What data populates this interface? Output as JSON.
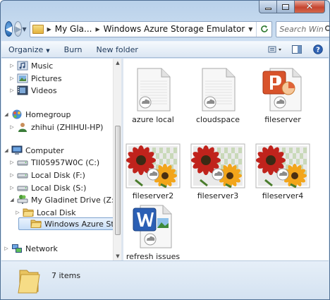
{
  "window": {
    "caption_buttons": {
      "minimize": "minimize",
      "maximize": "maximize",
      "close": "✕"
    }
  },
  "address": {
    "crumbs": [
      "My Gla...",
      "Windows Azure Storage Emulator"
    ],
    "search_placeholder": "Search Win..."
  },
  "toolbar": {
    "organize_label": "Organize",
    "burn_label": "Burn",
    "new_folder_label": "New folder"
  },
  "nav_tree": [
    {
      "label": "Music",
      "icon": "music-icon",
      "level": 1,
      "expander": "▷"
    },
    {
      "label": "Pictures",
      "icon": "pictures-icon",
      "level": 1,
      "expander": "▷"
    },
    {
      "label": "Videos",
      "icon": "videos-icon",
      "level": 1,
      "expander": "▷"
    },
    {
      "label": "Homegroup",
      "icon": "homegroup-icon",
      "level": 0,
      "expander": "◢"
    },
    {
      "label": "zhihui (ZHIHUI-HP)",
      "icon": "user-icon",
      "level": 1,
      "expander": "▷"
    },
    {
      "label": "Computer",
      "icon": "computer-icon",
      "level": 0,
      "expander": "◢"
    },
    {
      "label": "TII05957W0C (C:)",
      "icon": "drive-icon",
      "level": 1,
      "expander": "▷"
    },
    {
      "label": "Local Disk (F:)",
      "icon": "drive-icon",
      "level": 1,
      "expander": "▷"
    },
    {
      "label": "Local Disk (S:)",
      "icon": "drive-icon",
      "level": 1,
      "expander": "▷"
    },
    {
      "label": "My Gladinet Drive (Z:)",
      "icon": "network-drive-icon",
      "level": 1,
      "expander": "◢"
    },
    {
      "label": "Local Disk",
      "icon": "folder-icon",
      "level": 2,
      "expander": "▷"
    },
    {
      "label": "Windows Azure Storag",
      "icon": "folder-icon",
      "level": 2,
      "expander": "",
      "selected": true
    },
    {
      "label": "Network",
      "icon": "network-icon",
      "level": 0,
      "expander": "▷"
    }
  ],
  "files": [
    {
      "label": "azure local",
      "icon": "cloud-file-icon"
    },
    {
      "label": "cloudspace",
      "icon": "cloud-file-icon"
    },
    {
      "label": "fileserver",
      "icon": "powerpoint-file-icon"
    },
    {
      "label": "fileserver2",
      "icon": "flower-image-icon"
    },
    {
      "label": "fileserver3",
      "icon": "flower-image-icon"
    },
    {
      "label": "fileserver4",
      "icon": "flower-image-icon"
    },
    {
      "label": "refresh issues",
      "icon": "word-file-icon"
    }
  ],
  "status": {
    "item_count": "7 items"
  },
  "colors": {
    "selection_border": "#7da2ce",
    "window_frame": "#b9d1ea",
    "close_button": "#c6452f"
  }
}
